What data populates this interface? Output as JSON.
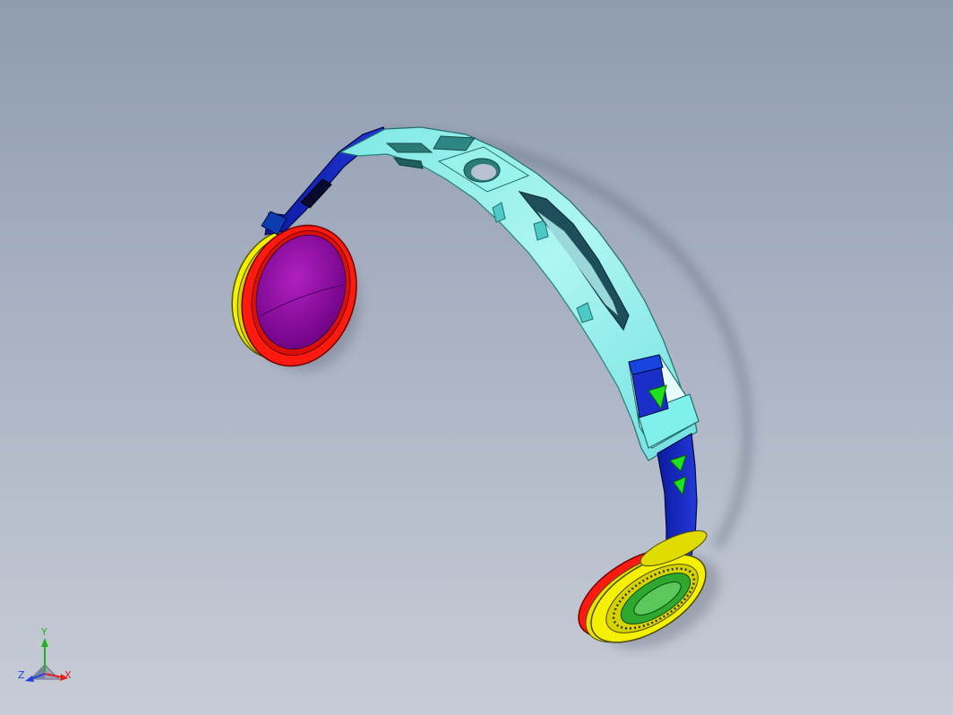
{
  "viewport": {
    "background_top": "#8e9bb1",
    "background_bottom": "#c7ccd6"
  },
  "model": {
    "parts": [
      {
        "name": "headband",
        "color": "#80f0ea"
      },
      {
        "name": "slider-arm",
        "color": "#1a2ec8"
      },
      {
        "name": "left-cushion-ring",
        "color": "#ff1a10"
      },
      {
        "name": "left-cushion-back",
        "color": "#f5f000"
      },
      {
        "name": "left-speaker-cover",
        "color": "#8a0aa0"
      },
      {
        "name": "right-cushion-ring",
        "color": "#ff1a10"
      },
      {
        "name": "right-earcup",
        "color": "#f5f000"
      },
      {
        "name": "right-speaker-grille",
        "color": "#2ea82e"
      },
      {
        "name": "slot-marker",
        "color": "#20e020"
      }
    ]
  },
  "triad": {
    "x_label": "X",
    "y_label": "Y",
    "z_label": "Z",
    "x_color": "#e02020",
    "y_color": "#20b020",
    "z_color": "#2040e0"
  }
}
